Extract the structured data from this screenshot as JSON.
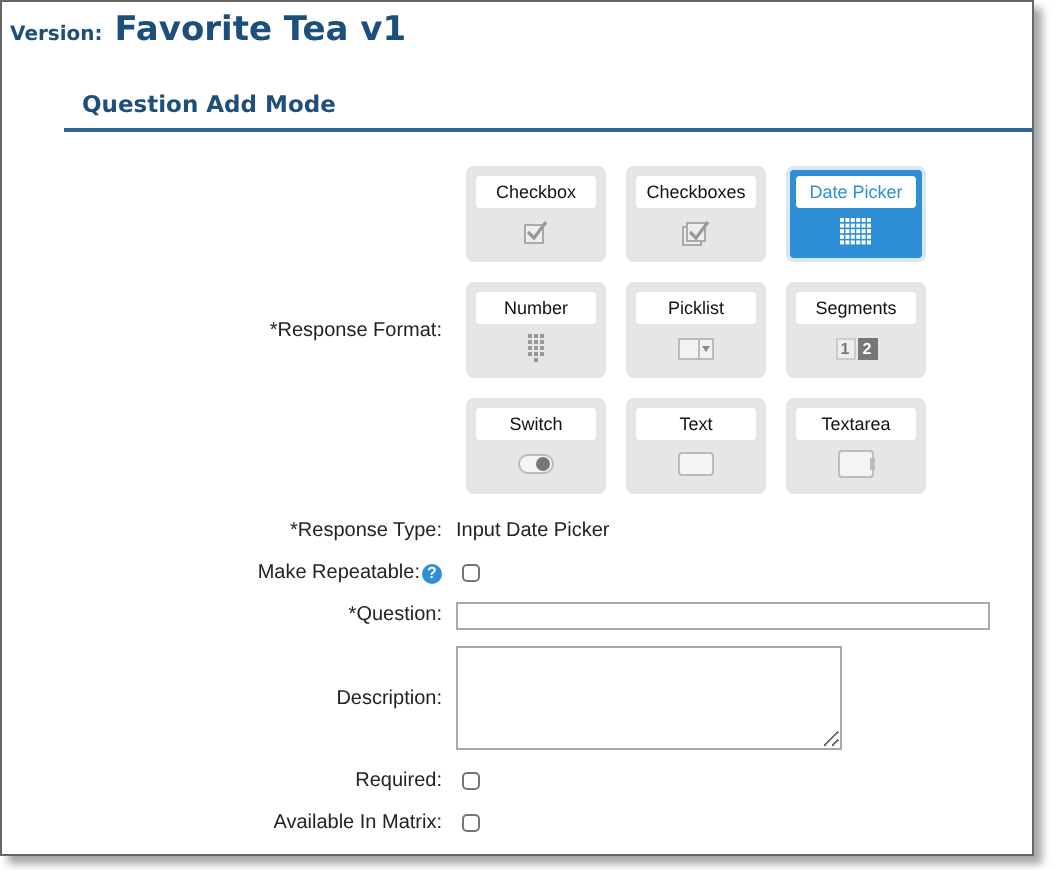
{
  "header": {
    "version_label": "Version:",
    "title": "Favorite Tea v1"
  },
  "section_title": "Question Add Mode",
  "response_format": {
    "label": "*Response Format:",
    "options": [
      {
        "label": "Checkbox",
        "kind": "checkbox",
        "selected": false
      },
      {
        "label": "Checkboxes",
        "kind": "checkboxes",
        "selected": false
      },
      {
        "label": "Date Picker",
        "kind": "datepicker",
        "selected": true
      },
      {
        "label": "Number",
        "kind": "number",
        "selected": false
      },
      {
        "label": "Picklist",
        "kind": "picklist",
        "selected": false
      },
      {
        "label": "Segments",
        "kind": "segments",
        "selected": false,
        "segments": [
          "1",
          "2"
        ]
      },
      {
        "label": "Switch",
        "kind": "switch",
        "selected": false
      },
      {
        "label": "Text",
        "kind": "text",
        "selected": false
      },
      {
        "label": "Textarea",
        "kind": "textarea",
        "selected": false
      }
    ]
  },
  "fields": [
    {
      "label": "*Response Type:",
      "kind": "static",
      "value": "Input Date Picker"
    },
    {
      "label": "Make Repeatable:",
      "kind": "checkbox",
      "checked": false,
      "help": "?"
    },
    {
      "label": "*Question:",
      "kind": "input"
    },
    {
      "label": "Description:",
      "kind": "textarea"
    },
    {
      "label": "Required:",
      "kind": "checkbox",
      "checked": false
    },
    {
      "label": "Available In Matrix:",
      "kind": "checkbox",
      "checked": false
    }
  ]
}
